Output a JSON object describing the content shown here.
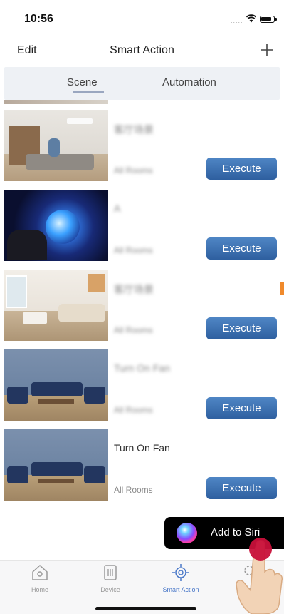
{
  "status_bar": {
    "time": "10:56",
    "signal": "....."
  },
  "nav": {
    "edit_label": "Edit",
    "title": "Smart Action"
  },
  "tabs": [
    {
      "label": "Scene",
      "active": true
    },
    {
      "label": "Automation",
      "active": false
    }
  ],
  "scenes": [
    {
      "name": "客厅场景",
      "room": "All Rooms",
      "blurred": true,
      "execute_label": "Execute"
    },
    {
      "name": "A",
      "room": "All Rooms",
      "blurred": true,
      "execute_label": "Execute"
    },
    {
      "name": "客厅场景",
      "room": "All Rooms",
      "blurred": true,
      "execute_label": "Execute"
    },
    {
      "name": "Turn On Fan",
      "room": "All Rooms",
      "blurred": true,
      "execute_label": "Execute"
    },
    {
      "name": "Turn On Fan",
      "room": "All Rooms",
      "blurred": false,
      "execute_label": "Execute"
    }
  ],
  "siri": {
    "label": "Add to Siri"
  },
  "tabbar": [
    {
      "label": "Home",
      "icon": "home-icon",
      "active": false
    },
    {
      "label": "Device",
      "icon": "device-icon",
      "active": false
    },
    {
      "label": "Smart Action",
      "icon": "smart-action-icon",
      "active": true
    },
    {
      "label": "Settings",
      "icon": "settings-icon",
      "active": false
    }
  ],
  "colors": {
    "accent": "#4a78c8",
    "execute": "#3a6fb0",
    "tabs_bg": "#eef1f5",
    "orange": "#f08a2c"
  }
}
